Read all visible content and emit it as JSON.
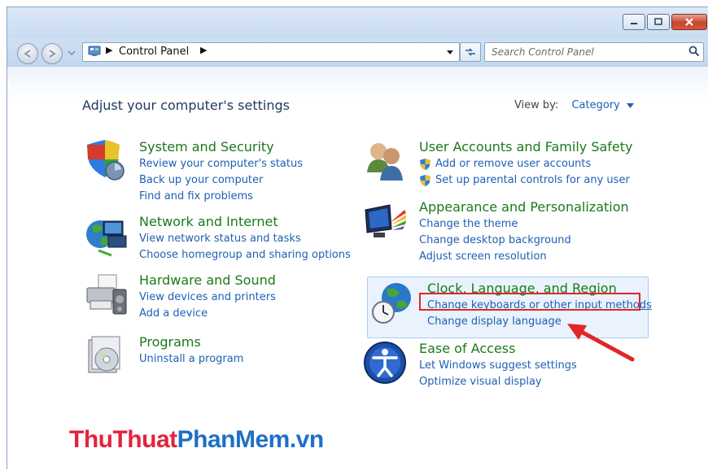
{
  "window": {
    "title_buttons": [
      "minimize-icon",
      "maximize-icon",
      "close-icon"
    ],
    "accent_color": "#c8452c"
  },
  "address": {
    "crumbs": [
      "Control Panel"
    ],
    "search_placeholder": "Search Control Panel"
  },
  "header": {
    "page_title": "Adjust your computer's settings",
    "view_by_label": "View by:",
    "view_by_value": "Category"
  },
  "categories": [
    {
      "title": "System and Security",
      "icon": "shield-security-icon",
      "links": [
        "Review your computer's status",
        "Back up your computer",
        "Find and fix problems"
      ]
    },
    {
      "title": "Network and Internet",
      "icon": "network-globe-icon",
      "links": [
        "View network status and tasks",
        "Choose homegroup and sharing options"
      ]
    },
    {
      "title": "Hardware and Sound",
      "icon": "printer-icon",
      "links": [
        "View devices and printers",
        "Add a device"
      ]
    },
    {
      "title": "Programs",
      "icon": "programs-disc-icon",
      "links": [
        "Uninstall a program"
      ]
    },
    {
      "title": "User Accounts and Family Safety",
      "icon": "users-icon",
      "links": [
        "Add or remove user accounts",
        "Set up parental controls for any user"
      ]
    },
    {
      "title": "Appearance and Personalization",
      "icon": "monitor-paint-icon",
      "links": [
        "Change the theme",
        "Change desktop background",
        "Adjust screen resolution"
      ]
    },
    {
      "title": "Clock, Language, and Region",
      "icon": "clock-globe-icon",
      "links": [
        "Change keyboards or other input methods",
        "Change display language"
      ]
    },
    {
      "title": "Ease of Access",
      "icon": "ease-of-access-icon",
      "links": [
        "Let Windows suggest settings",
        "Optimize visual display"
      ]
    }
  ],
  "watermark": {
    "part1": "ThuThuat",
    "part2": "PhanMem.vn"
  }
}
